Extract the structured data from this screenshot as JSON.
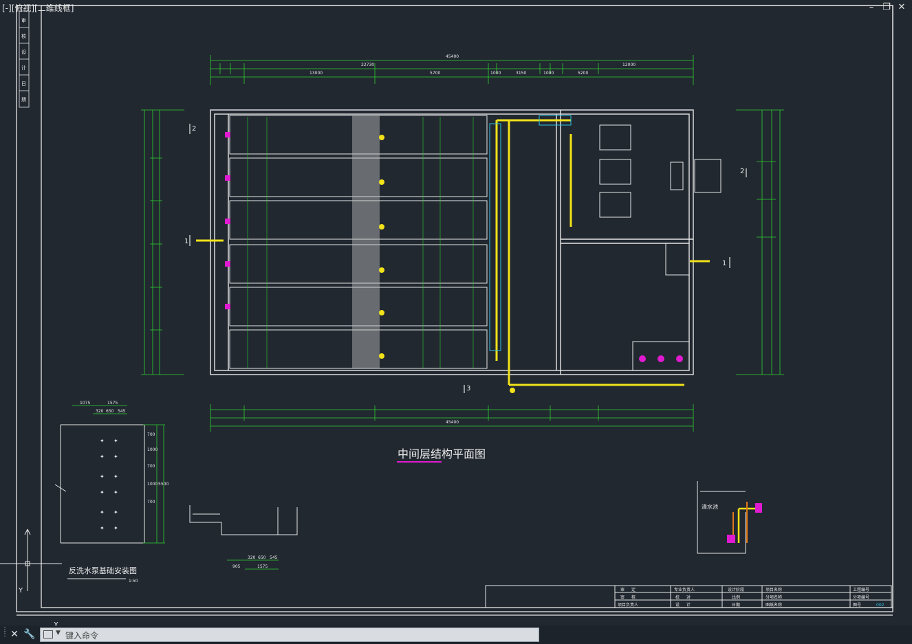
{
  "viewport": {
    "label": "[-][俯视][二维线框]",
    "controls": [
      "–",
      "❐",
      "✕"
    ]
  },
  "drawing": {
    "main_title": "中间层结构平面图",
    "detail_title": "反洗水泵基础安装图",
    "detail_scale": "1:50",
    "tank_label": "清水池",
    "top_total_dim": "45400",
    "bottom_total_dim": "45400",
    "top_dims": [
      "13000",
      "22730",
      "5700",
      "1000",
      "3150",
      "1000",
      "5200",
      "12000"
    ],
    "detail_dims_top": [
      "1075",
      "1575"
    ],
    "detail_dims_mid": [
      "320",
      "650",
      "545"
    ],
    "detail_dims_right": [
      "700",
      "1000",
      "700",
      "1000",
      "700",
      "5500"
    ],
    "detail2_dims": [
      "320",
      "650",
      "545",
      "905",
      "1575"
    ],
    "section_marks": [
      "1",
      "1",
      "2",
      "2",
      "3"
    ],
    "side_strip": [
      "审",
      "核",
      "设",
      "计",
      "日",
      "期"
    ]
  },
  "title_block": {
    "rows": [
      [
        "审",
        "定",
        "专业负责人",
        "设计阶段",
        "项目名称",
        "工程编号"
      ],
      [
        "审",
        "核",
        "校",
        "对",
        "比例",
        "分项名称",
        "分项编号"
      ],
      [
        "项目负责人",
        "设",
        "计",
        "日期",
        "图纸名称",
        "图号",
        "002"
      ]
    ]
  },
  "command": {
    "placeholder": "键入命令",
    "close_label": "✕",
    "settings_label": "🔧"
  },
  "colors": {
    "background": "#212830",
    "line_white": "#e8e8e8",
    "dim_green": "#2fd22f",
    "pipe_yellow": "#f2e21a",
    "accent_magenta": "#e01ad0",
    "accent_cyan": "#2ec4e6",
    "accent_red": "#e02020"
  }
}
